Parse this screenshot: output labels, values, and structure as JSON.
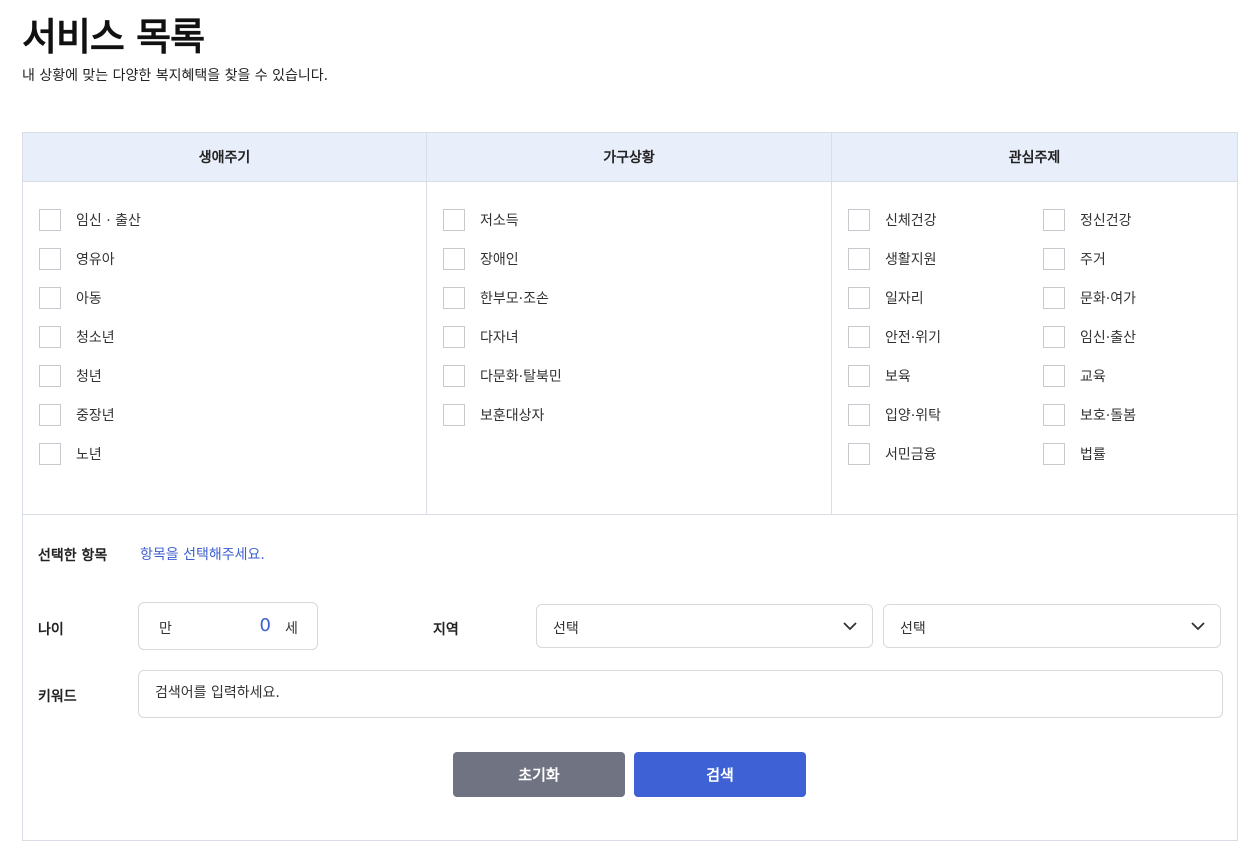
{
  "header": {
    "title": "서비스 목록",
    "subtitle": "내 상황에 맞는 다양한 복지혜택을 찾을 수 있습니다."
  },
  "categories": [
    {
      "title": "생애주기",
      "items": [
        "임신 · 출산",
        "영유아",
        "아동",
        "청소년",
        "청년",
        "중장년",
        "노년"
      ]
    },
    {
      "title": "가구상황",
      "items": [
        "저소득",
        "장애인",
        "한부모·조손",
        "다자녀",
        "다문화·탈북민",
        "보훈대상자"
      ]
    },
    {
      "title": "관심주제",
      "items": [
        "신체건강",
        "정신건강",
        "생활지원",
        "주거",
        "일자리",
        "문화·여가",
        "안전·위기",
        "임신·출산",
        "보육",
        "교육",
        "입양·위탁",
        "보호·돌봄",
        "서민금융",
        "법률"
      ]
    }
  ],
  "form": {
    "selected_label": "선택한 항목",
    "selected_hint": "항목을 선택해주세요.",
    "age_label": "나이",
    "age_prefix": "만",
    "age_value": "0",
    "age_suffix": "세",
    "region_label": "지역",
    "region_select_1": "선택",
    "region_select_2": "선택",
    "keyword_label": "키워드",
    "keyword_placeholder": "검색어를 입력하세요."
  },
  "buttons": {
    "reset": "초기화",
    "search": "검색"
  },
  "colors": {
    "accent": "#3e62d6",
    "header_bg": "#e9eefb",
    "reset_button": "#707382"
  }
}
